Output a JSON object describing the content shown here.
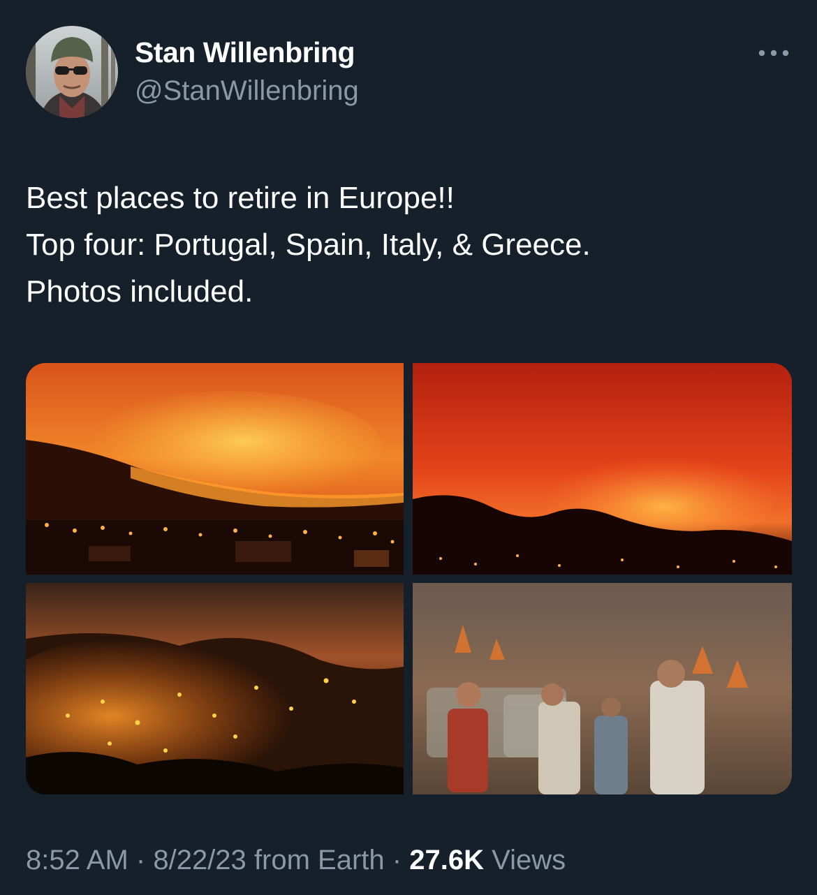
{
  "author": {
    "display_name": "Stan Willenbring",
    "handle": "@StanWillenbring"
  },
  "tweet": {
    "text_lines": [
      "Best places to retire in Europe!!",
      "Top four: Portugal, Spain, Italy, & Greece.",
      "Photos included."
    ]
  },
  "media": {
    "photo_count": 4,
    "photos": [
      {
        "subject": "wildfire over hillside and town at night"
      },
      {
        "subject": "wildfire glow over dark ridge at night"
      },
      {
        "subject": "burning forested hill at night"
      },
      {
        "subject": "people standing near vehicles in smoke and fire"
      }
    ]
  },
  "meta": {
    "time": "8:52 AM",
    "separator": "·",
    "date": "8/22/23",
    "source": "from Earth",
    "views_count": "27.6K",
    "views_label": "Views"
  },
  "icons": {
    "more": "more-horizontal-icon"
  },
  "colors": {
    "background": "#15202b",
    "primary_text": "#ffffff",
    "secondary_text": "#8b98a5"
  }
}
